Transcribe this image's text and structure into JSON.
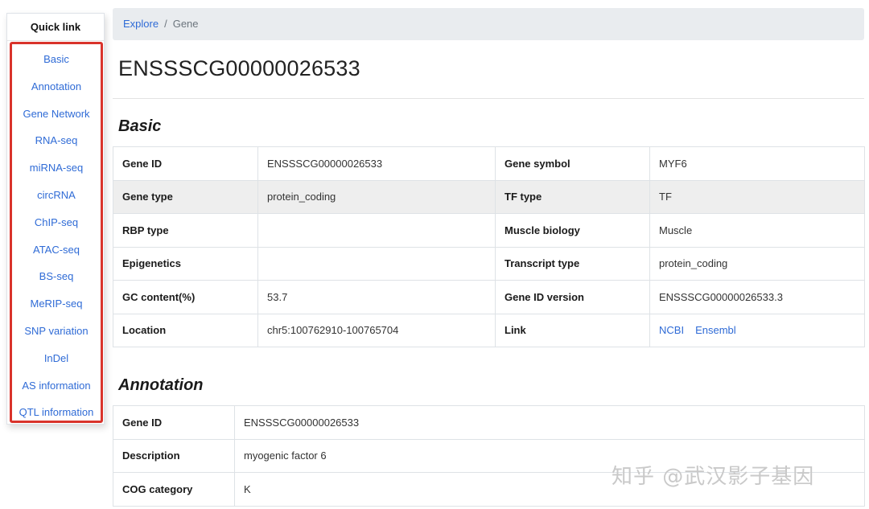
{
  "sidebar": {
    "title": "Quick link",
    "items": [
      "Basic",
      "Annotation",
      "Gene Network",
      "RNA-seq",
      "miRNA-seq",
      "circRNA",
      "ChIP-seq",
      "ATAC-seq",
      "BS-seq",
      "MeRIP-seq",
      "SNP variation",
      "InDel",
      "AS information",
      "QTL information"
    ]
  },
  "breadcrumb": {
    "root": "Explore",
    "separator": "/",
    "current": "Gene"
  },
  "page": {
    "title": "ENSSSCG00000026533"
  },
  "basic": {
    "heading": "Basic",
    "rows": [
      {
        "l1": "Gene ID",
        "v1": "ENSSSCG00000026533",
        "l2": "Gene symbol",
        "v2": "MYF6"
      },
      {
        "l1": "Gene type",
        "v1": "protein_coding",
        "l2": "TF type",
        "v2": "TF"
      },
      {
        "l1": "RBP type",
        "v1": "",
        "l2": "Muscle biology",
        "v2": "Muscle"
      },
      {
        "l1": "Epigenetics",
        "v1": "",
        "l2": "Transcript type",
        "v2": "protein_coding"
      },
      {
        "l1": "GC content(%)",
        "v1": "53.7",
        "l2": "Gene ID version",
        "v2": "ENSSSCG00000026533.3"
      },
      {
        "l1": "Location",
        "v1": "chr5:100762910-100765704",
        "l2": "Link",
        "links": [
          "NCBI",
          "Ensembl"
        ]
      }
    ]
  },
  "annotation": {
    "heading": "Annotation",
    "rows": [
      {
        "label": "Gene ID",
        "value": "ENSSSCG00000026533"
      },
      {
        "label": "Description",
        "value": "myogenic factor 6"
      },
      {
        "label": "COG category",
        "value": "K"
      }
    ]
  },
  "watermark": "知乎 @武汉影子基因",
  "colors": {
    "highlight_border": "#d9332b",
    "link": "#2f6bd6",
    "breadcrumb_bg": "#e9ecef",
    "shaded_row": "#eeeeee"
  }
}
